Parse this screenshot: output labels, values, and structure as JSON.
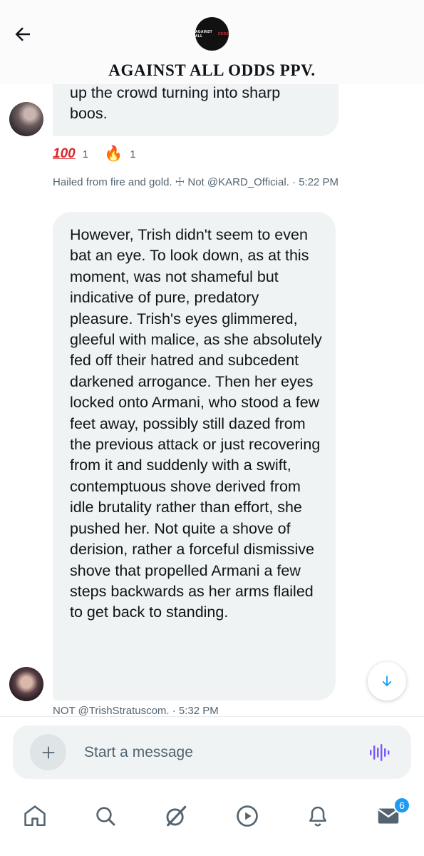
{
  "header": {
    "title": "AGAINST ALL ODDS PPV.",
    "logo_text_white": "AGAINST ALL",
    "logo_text_red": "ODDS",
    "back_icon": "arrow-left-icon"
  },
  "messages": [
    {
      "partial_text_top": "up the crowd turning into sharp",
      "text_end": "boos.",
      "reactions": [
        {
          "emoji": "💯",
          "count": "1",
          "icon": "hundred-emoji-icon"
        },
        {
          "emoji": "🔥",
          "count": "1",
          "icon": "fire-emoji-icon"
        }
      ],
      "meta": "Hailed from fire and gold. ☩ Not @KARD_Official. · 5:22 PM"
    },
    {
      "text": "However, Trish didn't seem to even bat an eye. To look down, as at this moment, was not shameful but indicative of pure, predatory pleasure. Trish's eyes glimmered, gleeful with malice, as she absolutely fed off their hatred and subcedent darkened arrogance. Then her eyes locked onto Armani, who stood a few feet away, possibly still dazed from the previous attack or just recovering from it and suddenly with a swift, contemptuous shove derived from idle brutality rather than effort, she pushed her. Not quite a shove of derision, rather a forceful dismissive shove that propelled Armani a few steps backwards as her arms flailed to get back to standing.",
      "meta": "NOT @TrishStratuscom. · 5:32 PM"
    }
  ],
  "composer": {
    "placeholder": "Start a message",
    "plus_icon": "plus-icon",
    "voice_icon": "voice-waveform-icon"
  },
  "nav": {
    "items": [
      "home-icon",
      "search-icon",
      "grok-icon",
      "video-icon",
      "notifications-icon",
      "messages-icon"
    ],
    "messages_badge": "6"
  },
  "colors": {
    "bubble": "#eff3f4",
    "accent": "#1d9bf0",
    "secondary_text": "#536471",
    "voice_icon": "#7856ff"
  }
}
